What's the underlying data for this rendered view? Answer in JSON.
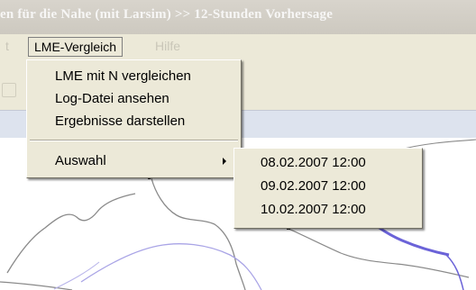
{
  "window": {
    "title": "en für die Nahe (mit Larsim) >> 12-Stunden Vorhersage"
  },
  "menubar": {
    "items": [
      {
        "label": "t"
      },
      {
        "label": "LME-Vergleich"
      },
      {
        "label": "Hilfe"
      }
    ]
  },
  "menu": {
    "items": [
      {
        "label": "LME mit N vergleichen"
      },
      {
        "label": "Log-Datei ansehen"
      },
      {
        "label": "Ergebnisse darstellen"
      },
      {
        "label": "Auswahl"
      }
    ]
  },
  "submenu": {
    "items": [
      {
        "label": "08.02.2007 12:00"
      },
      {
        "label": "09.02.2007 12:00"
      },
      {
        "label": "10.02.2007 12:00"
      }
    ]
  },
  "colors": {
    "menu_bg": "#ece9d8",
    "river": "#6b63d8",
    "border_line": "#8a8a8a",
    "status_strip": "#dde3ee"
  },
  "icons": [
    "submenu-arrow-icon",
    "toolbar-icon"
  ]
}
